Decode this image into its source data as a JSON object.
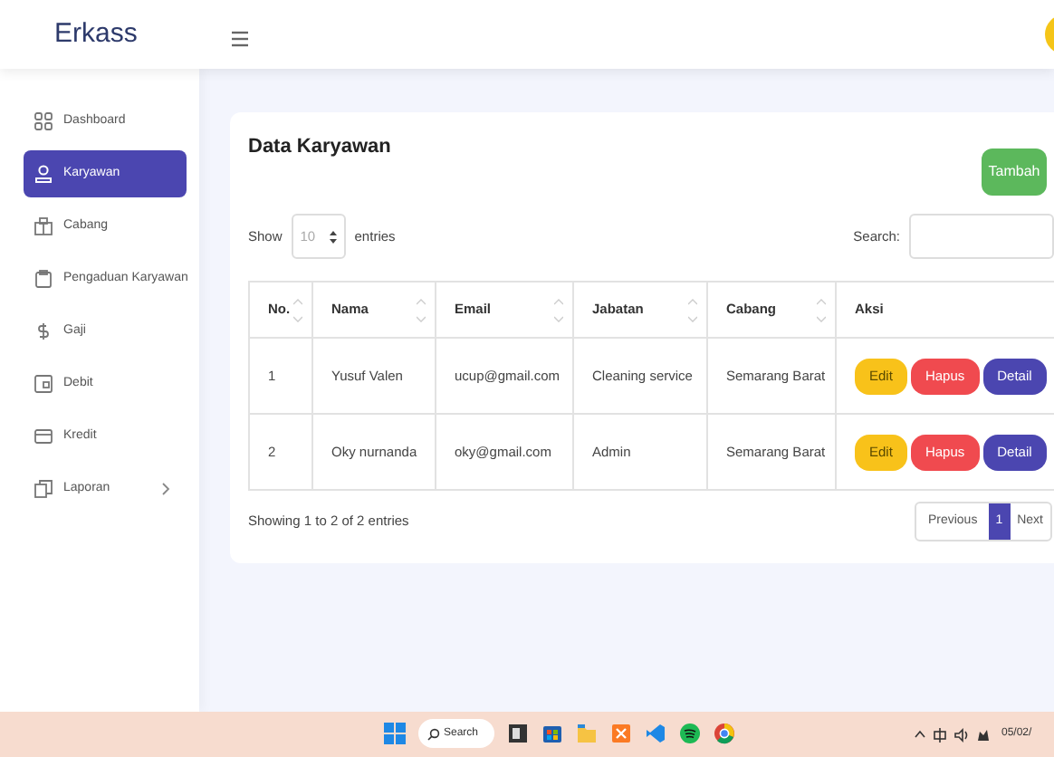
{
  "header": {
    "logo": "Erkass"
  },
  "sidebar": {
    "items": [
      {
        "label": "Dashboard",
        "selected": false
      },
      {
        "label": "Karyawan",
        "selected": true
      },
      {
        "label": "Cabang",
        "selected": false
      },
      {
        "label": "Pengaduan Karyawan",
        "selected": false
      },
      {
        "label": "Gaji",
        "selected": false
      },
      {
        "label": "Debit",
        "selected": false
      },
      {
        "label": "Kredit",
        "selected": false
      },
      {
        "label": "Laporan",
        "selected": false,
        "has_submenu": true
      }
    ]
  },
  "card": {
    "title": "Data Karyawan",
    "add_button": "Tambah",
    "length": {
      "show": "Show",
      "value": "10",
      "suffix": "entries"
    },
    "search": {
      "label": "Search:"
    },
    "table": {
      "columns": [
        "No.",
        "Nama",
        "Email",
        "Jabatan",
        "Cabang",
        "Aksi"
      ],
      "rows": [
        {
          "cells": [
            "1",
            "Yusuf Valen",
            "ucup@gmail.com",
            "Cleaning service",
            "Semarang Barat"
          ],
          "actions": [
            {
              "label": "Edit",
              "kind": "edit"
            },
            {
              "label": "Hapus",
              "kind": "delete"
            },
            {
              "label": "Detail",
              "kind": "detail"
            }
          ]
        },
        {
          "cells": [
            "2",
            "Oky nurnanda",
            "oky@gmail.com",
            "Admin",
            "Semarang Barat"
          ],
          "actions": [
            {
              "label": "Edit",
              "kind": "edit"
            },
            {
              "label": "Hapus",
              "kind": "delete"
            },
            {
              "label": "Detail",
              "kind": "detail"
            }
          ]
        }
      ]
    },
    "info": "Showing 1 to 2 of 2 entries",
    "pagination": {
      "previous": "Previous",
      "pages": [
        {
          "label": "1",
          "selected": true
        }
      ],
      "next": "Next"
    }
  },
  "taskbar": {
    "search": "Search",
    "date": "05/02/"
  }
}
